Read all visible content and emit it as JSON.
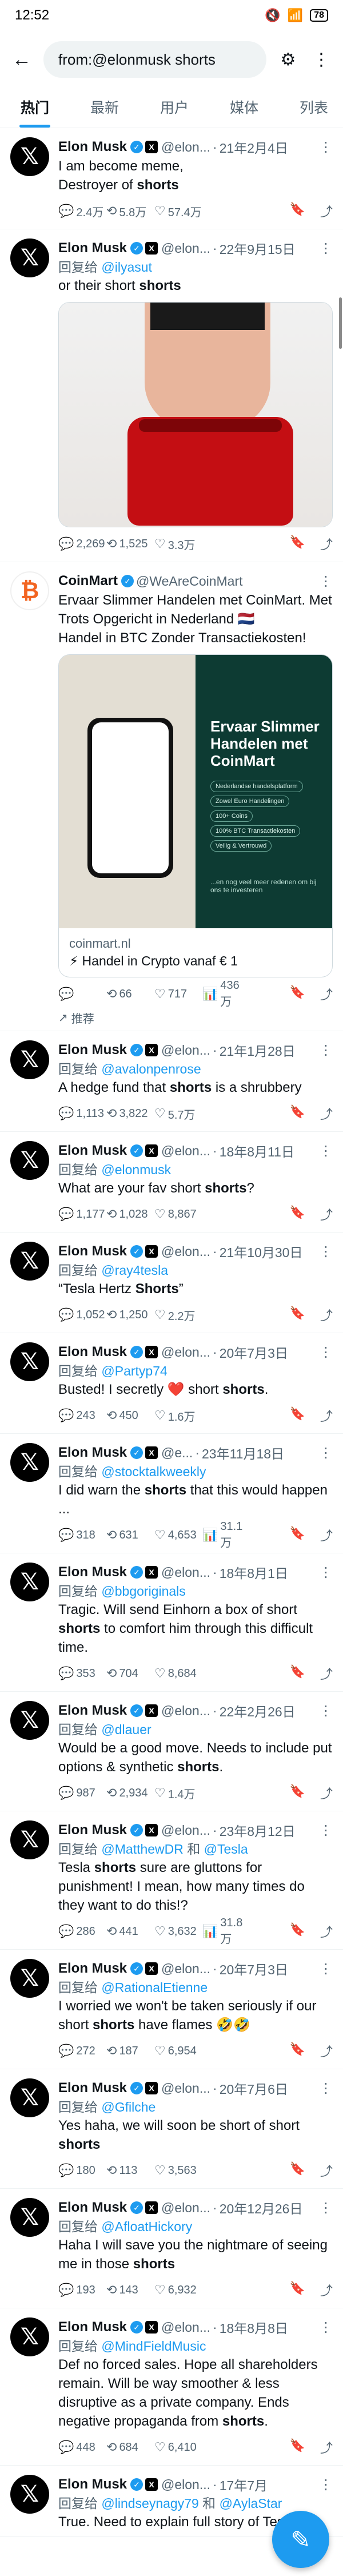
{
  "status": {
    "time": "12:52",
    "battery": "78"
  },
  "search": {
    "query": "from:@elonmusk shorts"
  },
  "tabs": [
    "热门",
    "最新",
    "用户",
    "媒体",
    "列表"
  ],
  "tweets": [
    {
      "name": "Elon Musk",
      "handle": "@elon...",
      "date": "21年2月4日",
      "reply_prefix": "",
      "reply_mentions": [],
      "text": "I am become meme,\nDestroyer of <b>shorts</b>",
      "metrics": {
        "replies": "2.4万",
        "retweets": "5.8万",
        "likes": "57.4万"
      },
      "media": ""
    },
    {
      "name": "Elon Musk",
      "handle": "@elon...",
      "date": "22年9月15日",
      "reply_prefix": "回复给",
      "reply_mentions": [
        "@ilyasut"
      ],
      "text": "or their short <b>shorts</b>",
      "metrics": {
        "replies": "2,269",
        "retweets": "1,525",
        "likes": "3.3万"
      },
      "media": "shorts-photo"
    },
    {
      "name": "Elon Musk",
      "handle": "@elon...",
      "date": "21年1月28日",
      "reply_prefix": "回复给",
      "reply_mentions": [
        "@avalonpenrose"
      ],
      "text": "A hedge fund that <b>shorts</b> is a shrubbery",
      "metrics": {
        "replies": "1,113",
        "retweets": "3,822",
        "likes": "5.7万"
      },
      "media": ""
    },
    {
      "name": "Elon Musk",
      "handle": "@elon...",
      "date": "18年8月11日",
      "reply_prefix": "回复给",
      "reply_mentions": [
        "@elonmusk"
      ],
      "text": "What are your fav short <b>shorts</b>?",
      "metrics": {
        "replies": "1,177",
        "retweets": "1,028",
        "likes": "8,867"
      },
      "media": ""
    },
    {
      "name": "Elon Musk",
      "handle": "@elon...",
      "date": "21年10月30日",
      "reply_prefix": "回复给",
      "reply_mentions": [
        "@ray4tesla"
      ],
      "text": "“Tesla Hertz <b>Shorts</b>”",
      "metrics": {
        "replies": "1,052",
        "retweets": "1,250",
        "likes": "2.2万"
      },
      "media": ""
    },
    {
      "name": "Elon Musk",
      "handle": "@elon...",
      "date": "20年7月3日",
      "reply_prefix": "回复给",
      "reply_mentions": [
        "@Partyp74"
      ],
      "text": "Busted! I secretly ❤️ short <b>shorts</b>.",
      "metrics": {
        "replies": "243",
        "retweets": "450",
        "likes": "1.6万"
      },
      "media": ""
    },
    {
      "name": "Elon Musk",
      "handle": "@e...",
      "date": "23年11月18日",
      "reply_prefix": "回复给",
      "reply_mentions": [
        "@stocktalkweekly"
      ],
      "text": "I did warn the <b>shorts</b> that this would happen ...",
      "metrics": {
        "replies": "318",
        "retweets": "631",
        "likes": "4,653"
      },
      "views": "31.1万",
      "media": ""
    },
    {
      "name": "Elon Musk",
      "handle": "@elon...",
      "date": "18年8月1日",
      "reply_prefix": "回复给",
      "reply_mentions": [
        "@bbgoriginals"
      ],
      "text": "Tragic. Will send Einhorn a box of short <b>shorts</b> to comfort him through this difficult time.",
      "metrics": {
        "replies": "353",
        "retweets": "704",
        "likes": "8,684"
      },
      "media": ""
    },
    {
      "name": "Elon Musk",
      "handle": "@elon...",
      "date": "22年2月26日",
      "reply_prefix": "回复给",
      "reply_mentions": [
        "@dlauer"
      ],
      "text": "Would be a good move. Needs to include put options & synthetic <b>shorts</b>.",
      "metrics": {
        "replies": "987",
        "retweets": "2,934",
        "likes": "1.4万"
      },
      "media": ""
    },
    {
      "name": "Elon Musk",
      "handle": "@elon...",
      "date": "23年8月12日",
      "reply_prefix": "回复给",
      "reply_mentions": [
        "@MatthewDR",
        "和",
        "@Tesla"
      ],
      "text": "Tesla <b>shorts</b> sure are gluttons for punishment! I mean, how many times do they want to do this!?",
      "metrics": {
        "replies": "286",
        "retweets": "441",
        "likes": "3,632"
      },
      "views": "31.8万",
      "media": ""
    },
    {
      "name": "Elon Musk",
      "handle": "@elon...",
      "date": "20年7月3日",
      "reply_prefix": "回复给",
      "reply_mentions": [
        "@RationalEtienne"
      ],
      "text": "I worried we won't be taken seriously if our short <b>shorts</b> have flames 🤣🤣",
      "metrics": {
        "replies": "272",
        "retweets": "187",
        "likes": "6,954"
      },
      "media": ""
    },
    {
      "name": "Elon Musk",
      "handle": "@elon...",
      "date": "20年7月6日",
      "reply_prefix": "回复给",
      "reply_mentions": [
        "@Gfilche"
      ],
      "text": "Yes haha, we will soon be short of short <b>shorts</b>",
      "metrics": {
        "replies": "180",
        "retweets": "113",
        "likes": "3,563"
      },
      "media": ""
    },
    {
      "name": "Elon Musk",
      "handle": "@elon...",
      "date": "20年12月26日",
      "reply_prefix": "回复给",
      "reply_mentions": [
        "@AfloatHickory"
      ],
      "text": "Haha I will save you the nightmare of seeing me in those <b>shorts</b>",
      "metrics": {
        "replies": "193",
        "retweets": "143",
        "likes": "6,932"
      },
      "media": ""
    },
    {
      "name": "Elon Musk",
      "handle": "@elon...",
      "date": "18年8月8日",
      "reply_prefix": "回复给",
      "reply_mentions": [
        "@MindFieldMusic"
      ],
      "text": "Def no forced sales. Hope all shareholders remain. Will be way smoother & less disruptive as a private company. Ends negative propaganda from <b>shorts</b>.",
      "metrics": {
        "replies": "448",
        "retweets": "684",
        "likes": "6,410"
      },
      "media": ""
    },
    {
      "name": "Elon Musk",
      "handle": "@elon...",
      "date": "17年7月",
      "reply_prefix": "回复给",
      "reply_mentions": [
        "@lindseynagy79",
        "和",
        "@AylaStar"
      ],
      "text": "True. Need to explain full story of Tesla. So",
      "metrics": {
        "replies": "",
        "retweets": "",
        "likes": ""
      },
      "media": ""
    }
  ],
  "ad": {
    "name": "CoinMart",
    "handle": "@WeAreCoinMart",
    "text": "Ervaar Slimmer Handelen met CoinMart. Met Trots Opgericht in Nederland 🇳🇱\nHandel in BTC Zonder Transactiekosten!",
    "card_title": "Ervaar Slimmer Handelen met CoinMart",
    "card_pills": [
      "Nederlandse handelsplatform",
      "Zowel Euro Handelingen",
      "100+ Coins",
      "100% BTC Transactiekosten",
      "Veilig & Vertrouwd"
    ],
    "card_tag": "...en nog veel meer redenen om bij ons te investeren",
    "domain": "coinmart.nl",
    "headline": "⚡ Handel in Crypto vanaf € 1",
    "metrics": {
      "retweets": "66",
      "likes": "717",
      "views": "436万"
    },
    "promoted": "推荐"
  }
}
